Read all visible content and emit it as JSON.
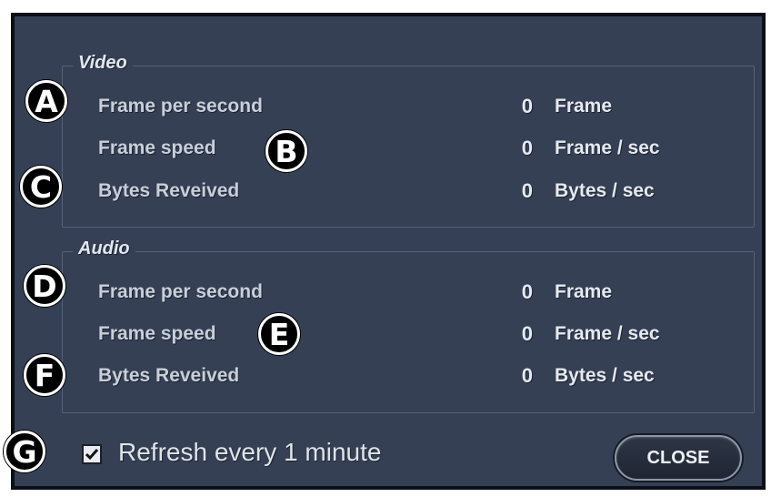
{
  "video": {
    "title": "Video",
    "rows": [
      {
        "label": "Frame per second",
        "value": "0",
        "unit": "Frame"
      },
      {
        "label": "Frame speed",
        "value": "0",
        "unit": "Frame / sec"
      },
      {
        "label": "Bytes Reveived",
        "value": "0",
        "unit": "Bytes / sec"
      }
    ]
  },
  "audio": {
    "title": "Audio",
    "rows": [
      {
        "label": "Frame per second",
        "value": "0",
        "unit": "Frame"
      },
      {
        "label": "Frame speed",
        "value": "0",
        "unit": "Frame / sec"
      },
      {
        "label": "Bytes Reveived",
        "value": "0",
        "unit": "Bytes / sec"
      }
    ]
  },
  "refresh": {
    "label": "Refresh every 1 minute",
    "checked": true
  },
  "close_label": "CLOSE",
  "markers": [
    "A",
    "B",
    "C",
    "D",
    "E",
    "F",
    "G"
  ]
}
